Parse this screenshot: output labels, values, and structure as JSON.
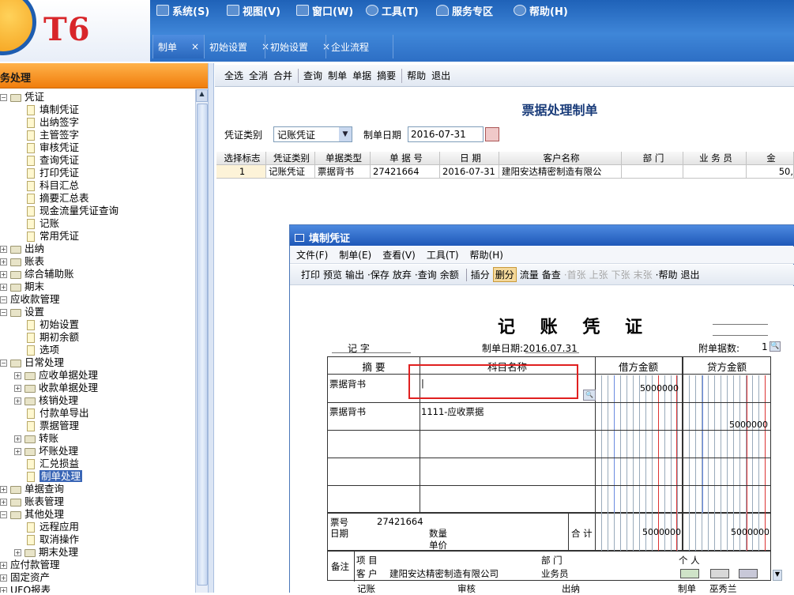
{
  "app": {
    "logo_text": "T6"
  },
  "menu": {
    "system": "系统(S)",
    "view": "视图(V)",
    "window": "窗口(W)",
    "tools": "工具(T)",
    "service": "服务专区",
    "help": "帮助(H)"
  },
  "tabs": [
    {
      "label": "制单"
    },
    {
      "label": "初始设置"
    },
    {
      "label": "初始设置"
    },
    {
      "label": "企业流程"
    }
  ],
  "tab_close": "×",
  "left": {
    "header": "务处理",
    "tree": [
      {
        "label": "凭证",
        "lvl": 1,
        "type": "folder",
        "pm": "−"
      },
      {
        "label": "填制凭证",
        "lvl": 2,
        "type": "doc"
      },
      {
        "label": "出纳签字",
        "lvl": 2,
        "type": "doc"
      },
      {
        "label": "主管签字",
        "lvl": 2,
        "type": "doc"
      },
      {
        "label": "审核凭证",
        "lvl": 2,
        "type": "doc"
      },
      {
        "label": "查询凭证",
        "lvl": 2,
        "type": "doc"
      },
      {
        "label": "打印凭证",
        "lvl": 2,
        "type": "doc"
      },
      {
        "label": "科目汇总",
        "lvl": 2,
        "type": "doc"
      },
      {
        "label": "摘要汇总表",
        "lvl": 2,
        "type": "doc"
      },
      {
        "label": "现金流量凭证查询",
        "lvl": 2,
        "type": "doc"
      },
      {
        "label": "记账",
        "lvl": 2,
        "type": "doc"
      },
      {
        "label": "常用凭证",
        "lvl": 2,
        "type": "doc"
      },
      {
        "label": "出纳",
        "lvl": 1,
        "type": "folder",
        "pm": "+"
      },
      {
        "label": "账表",
        "lvl": 1,
        "type": "folder",
        "pm": "+"
      },
      {
        "label": "综合辅助账",
        "lvl": 1,
        "type": "folder",
        "pm": "+"
      },
      {
        "label": "期末",
        "lvl": 1,
        "type": "folder",
        "pm": "+"
      },
      {
        "label": "应收款管理",
        "lvl": 0,
        "type": "none",
        "pm": "−"
      },
      {
        "label": "设置",
        "lvl": 1,
        "type": "folder",
        "pm": "−"
      },
      {
        "label": "初始设置",
        "lvl": 2,
        "type": "doc"
      },
      {
        "label": "期初余额",
        "lvl": 2,
        "type": "doc"
      },
      {
        "label": "选项",
        "lvl": 2,
        "type": "doc"
      },
      {
        "label": "日常处理",
        "lvl": 1,
        "type": "folder",
        "pm": "−"
      },
      {
        "label": "应收单据处理",
        "lvl": 2,
        "type": "folder",
        "pm": "+"
      },
      {
        "label": "收款单据处理",
        "lvl": 2,
        "type": "folder",
        "pm": "+"
      },
      {
        "label": "核销处理",
        "lvl": 2,
        "type": "folder",
        "pm": "+"
      },
      {
        "label": "付款单导出",
        "lvl": 2,
        "type": "doc"
      },
      {
        "label": "票据管理",
        "lvl": 2,
        "type": "doc"
      },
      {
        "label": "转账",
        "lvl": 2,
        "type": "folder",
        "pm": "+"
      },
      {
        "label": "坏账处理",
        "lvl": 2,
        "type": "folder",
        "pm": "+"
      },
      {
        "label": "汇兑损益",
        "lvl": 2,
        "type": "doc"
      },
      {
        "label": "制单处理",
        "lvl": 2,
        "type": "doc",
        "selected": true
      },
      {
        "label": "单据查询",
        "lvl": 1,
        "type": "folder",
        "pm": "+"
      },
      {
        "label": "账表管理",
        "lvl": 1,
        "type": "folder",
        "pm": "+"
      },
      {
        "label": "其他处理",
        "lvl": 1,
        "type": "folder",
        "pm": "−"
      },
      {
        "label": "远程应用",
        "lvl": 2,
        "type": "doc"
      },
      {
        "label": "取消操作",
        "lvl": 2,
        "type": "doc"
      },
      {
        "label": "期末处理",
        "lvl": 2,
        "type": "folder",
        "pm": "+"
      },
      {
        "label": "应付款管理",
        "lvl": 0,
        "type": "none",
        "pm": "+"
      },
      {
        "label": "固定资产",
        "lvl": 0,
        "type": "none",
        "pm": "+"
      },
      {
        "label": "UFO报表",
        "lvl": 0,
        "type": "none",
        "pm": "+"
      }
    ]
  },
  "toolbar": {
    "g1": [
      "全选",
      "全消",
      "合并"
    ],
    "g2": [
      "查询",
      "制单",
      "单据",
      "摘要"
    ],
    "g3": [
      "帮助",
      "退出"
    ]
  },
  "main": {
    "title": "票据处理制单",
    "voucher_type_label": "凭证类别",
    "voucher_type_value": "记账凭证",
    "date_label": "制单日期",
    "date_value": "2016-07-31",
    "columns": [
      "选择标志",
      "凭证类别",
      "单据类型",
      "单 据 号",
      "日  期",
      "客户名称",
      "部  门",
      "业 务 员",
      "金"
    ],
    "rows": [
      [
        "1",
        "记账凭证",
        "票据背书",
        "27421664",
        "2016-07-31",
        "建阳安达精密制造有限公",
        "",
        "",
        "50,"
      ]
    ]
  },
  "voucher": {
    "window_title": "填制凭证",
    "menu": [
      "文件(F)",
      "制单(E)",
      "查看(V)",
      "工具(T)",
      "帮助(H)"
    ],
    "toolbar": [
      {
        "t": "打印"
      },
      {
        "t": "预览"
      },
      {
        "t": "输出"
      },
      {
        "t": "·保存"
      },
      {
        "t": "放弃"
      },
      {
        "t": "·查询"
      },
      {
        "t": "余额"
      },
      {
        "t": "|"
      },
      {
        "t": "插分"
      },
      {
        "t": "删分",
        "act": true
      },
      {
        "t": "流量"
      },
      {
        "t": "备查"
      },
      {
        "t": "·首张",
        "dis": true
      },
      {
        "t": "上张",
        "dis": true
      },
      {
        "t": "下张",
        "dis": true
      },
      {
        "t": "末张",
        "dis": true
      },
      {
        "t": "·帮助"
      },
      {
        "t": "退出"
      }
    ],
    "heading": "记 账 凭 证",
    "word": "记    字",
    "date": "制单日期:2016.07.31",
    "attach_label": "附单据数:",
    "attach_value": "1",
    "col_summary": "摘  要",
    "col_subject": "科目名称",
    "col_debit": "借方金额",
    "col_credit": "贷方金额",
    "lines": [
      {
        "summary": "票据背书",
        "subject": "|",
        "debit": "5000000",
        "credit": ""
      },
      {
        "summary": "票据背书",
        "subject": "1111-应收票据",
        "debit": "",
        "credit": "5000000"
      },
      {
        "summary": "",
        "subject": "",
        "debit": "",
        "credit": ""
      },
      {
        "summary": "",
        "subject": "",
        "debit": "",
        "credit": ""
      },
      {
        "summary": "",
        "subject": "",
        "debit": "",
        "credit": ""
      }
    ],
    "bill_no_label": "票号",
    "bill_no": "27421664",
    "date_row_label": "日期",
    "qty_label": "数量",
    "price_label": "单价",
    "total_label": "合 计",
    "total_debit": "5000000",
    "total_credit": "5000000",
    "memo_label": "备注",
    "project_label": "项  目",
    "dept_label": "部  门",
    "person_label": "个  人",
    "customer_label": "客  户",
    "customer": "建阳安达精密制造有限公司",
    "salesman_label": "业务员",
    "footer": [
      "记账",
      "审核",
      "出纳",
      "制单",
      "巫秀兰"
    ]
  }
}
